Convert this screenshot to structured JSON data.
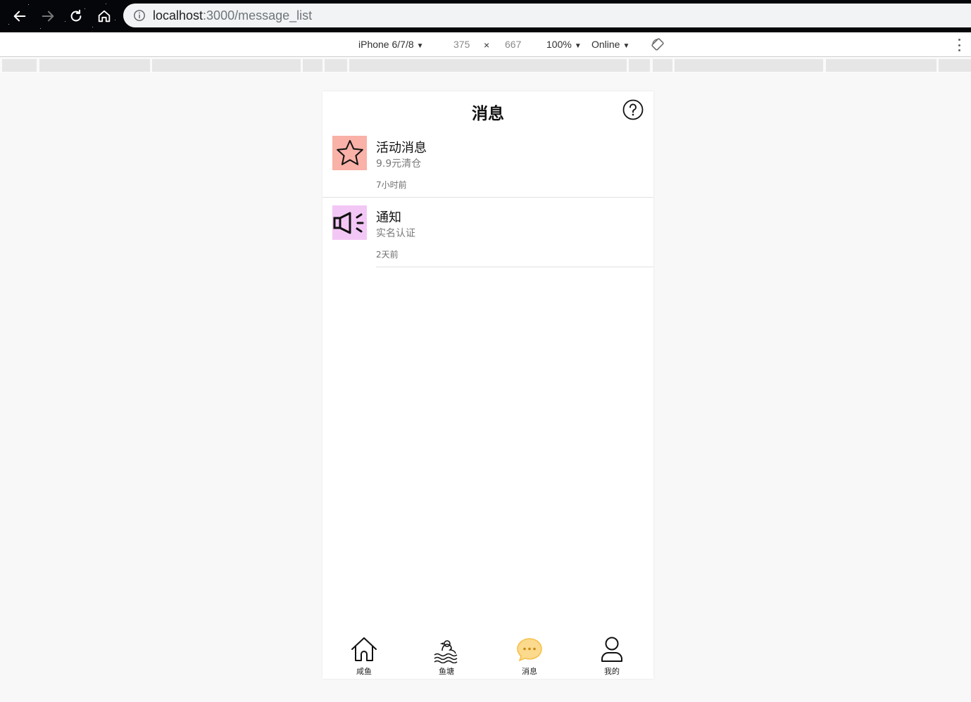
{
  "browser": {
    "url_host": "localhost",
    "url_path": ":3000/message_list"
  },
  "device_toolbar": {
    "device": "iPhone 6/7/8",
    "width": "375",
    "times": "×",
    "height": "667",
    "zoom": "100%",
    "network": "Online",
    "caret": "▼"
  },
  "header": {
    "title": "消息"
  },
  "messages": [
    {
      "title": "活动消息",
      "preview": "9.9元清仓",
      "time": "7小时前",
      "icon": "star-icon",
      "icon_bg": "#f9b1a8"
    },
    {
      "title": "通知",
      "preview": "实名认证",
      "time": "2天前",
      "icon": "megaphone-icon",
      "icon_bg": "#f3c7f5"
    }
  ],
  "tabbar": {
    "items": [
      {
        "label": "咸鱼",
        "icon": "home-icon"
      },
      {
        "label": "鱼塘",
        "icon": "pond-icon"
      },
      {
        "label": "消息",
        "icon": "chat-bubble-icon",
        "active": true
      },
      {
        "label": "我的",
        "icon": "user-icon"
      }
    ],
    "active_color": "#f7c04a"
  }
}
